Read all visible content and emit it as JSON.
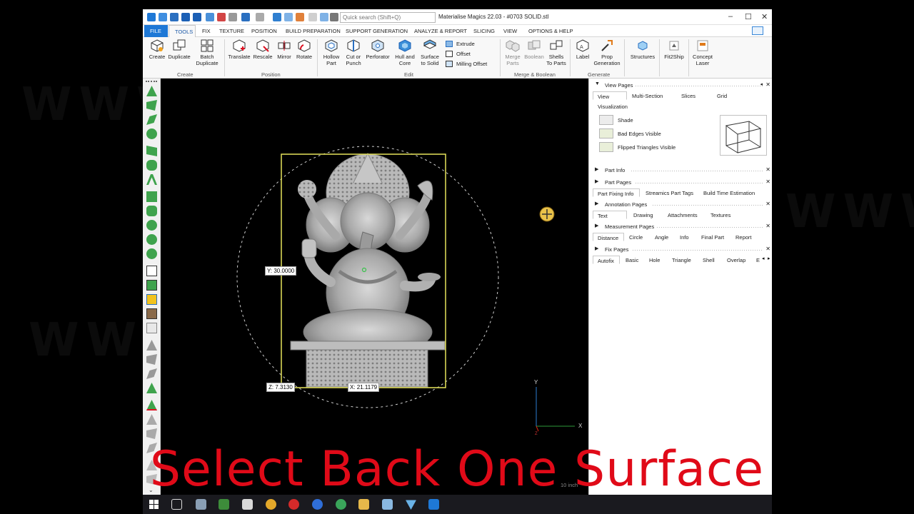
{
  "app": {
    "title": "Materialise Magics 22.03 - #0703 SOLID.stl",
    "search_placeholder": "Quick search (Shift+Q)",
    "window_controls": [
      "minimize-icon",
      "maximize-icon",
      "close-icon"
    ]
  },
  "ribbon_tabs": [
    "FILE",
    "TOOLS",
    "FIX",
    "TEXTURE",
    "POSITION",
    "BUILD PREPARATION",
    "SUPPORT GENERATION",
    "ANALYZE & REPORT",
    "SLICING",
    "VIEW",
    "OPTIONS & HELP"
  ],
  "active_tab": "TOOLS",
  "ribbon": {
    "create": {
      "label": "Create",
      "buttons": [
        "Create",
        "Duplicate",
        "Batch\nDuplicate"
      ]
    },
    "position": {
      "label": "Position",
      "buttons": [
        "Translate",
        "Rescale",
        "Mirror",
        "Rotate"
      ]
    },
    "edit": {
      "label": "Edit",
      "buttons": [
        "Hollow\nPart",
        "Cut or\nPunch",
        "Perforator",
        "Hull and\nCore",
        "Surface\nto Solid"
      ],
      "small": [
        "Extrude",
        "Offset",
        "Milling Offset"
      ]
    },
    "merge": {
      "label": "Merge & Boolean",
      "buttons": [
        "Merge\nParts",
        "Boolean",
        "Shells\nTo Parts"
      ]
    },
    "generate": {
      "label": "Generate",
      "buttons": [
        "Label",
        "Prop\nGeneration"
      ]
    },
    "extras": [
      "Structures",
      "Fit2Ship",
      "Concept\nLaser"
    ]
  },
  "viewport": {
    "y_label": "Y: 30.0000",
    "z_label": "Z: 7.3130",
    "x_label": "X: 21.1179",
    "axis_y": "Y",
    "axis_x": "X",
    "axis_z": "Z",
    "status": "10 inch"
  },
  "right_panel": {
    "view_pages": {
      "title": "View Pages",
      "tabs": [
        "View",
        "Multi-Section",
        "Slices",
        "Grid"
      ],
      "active_tab": "View",
      "section": "Visualization",
      "items": [
        "Shade",
        "Bad Edges Visible",
        "Flipped Triangles Visible"
      ]
    },
    "part_info": {
      "title": "Part Info"
    },
    "part_pages": {
      "title": "Part Pages",
      "tabs": [
        "Part Fixing Info",
        "Streamics Part Tags",
        "Build Time Estimation"
      ],
      "active_tab": "Part Fixing Info"
    },
    "annotation_pages": {
      "title": "Annotation Pages",
      "tabs": [
        "Text",
        "Drawing",
        "Attachments",
        "Textures"
      ],
      "active_tab": "Text"
    },
    "measurement_pages": {
      "title": "Measurement Pages",
      "tabs": [
        "Distance",
        "Circle",
        "Angle",
        "Info",
        "Final Part",
        "Report"
      ],
      "active_tab": "Distance"
    },
    "fix_pages": {
      "title": "Fix Pages",
      "tabs": [
        "Autofix",
        "Basic",
        "Hole",
        "Triangle",
        "Shell",
        "Overlap",
        "E"
      ],
      "active_tab": "Autofix"
    }
  },
  "caption": "Select Back One Surface",
  "colors": {
    "accent": "#1e78d6",
    "caption": "#e00a18",
    "bounding_box": "#e6e35a",
    "viewport_bg": "#000000",
    "panel_bg": "#ffffff"
  }
}
